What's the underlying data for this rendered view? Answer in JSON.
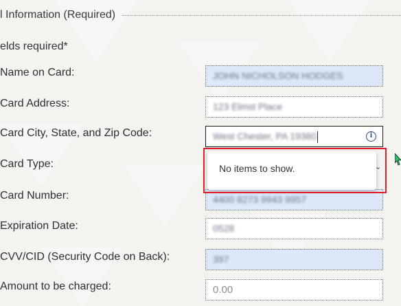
{
  "section": {
    "legend": "l Information (Required)",
    "required_note": "elds required*"
  },
  "fields": [
    {
      "label": "Name on Card:",
      "value": "JOHN NICHOLSON HODGES",
      "state": "autofill"
    },
    {
      "label": "Card Address:",
      "value": "123 Elmst Place",
      "state": "normal"
    },
    {
      "label": "Card City, State, and Zip Code:",
      "value": "West Chester, PA 19380",
      "state": "focused"
    },
    {
      "label": "Card Type:",
      "value": "",
      "state": "select"
    },
    {
      "label": "Card Number:",
      "value": "4400 8273 9943 9957",
      "state": "autofill"
    },
    {
      "label": "Expiration Date:",
      "value": "0528",
      "state": "normal"
    },
    {
      "label": "CVV/CID (Security Code on Back):",
      "value": "397",
      "state": "autofill"
    },
    {
      "label": "Amount to be charged:",
      "placeholder": "0.00",
      "state": "normal"
    }
  ],
  "dropdown": {
    "empty_message": "No items to show."
  },
  "icons": {
    "info": "info-circle-icon",
    "chevron": "chevron-down-icon",
    "cursor": "mouse-pointer-icon"
  },
  "colors": {
    "autofill_bg": "#dde9fb",
    "highlight": "#e01d28",
    "cursor": "#2bbf6a"
  }
}
